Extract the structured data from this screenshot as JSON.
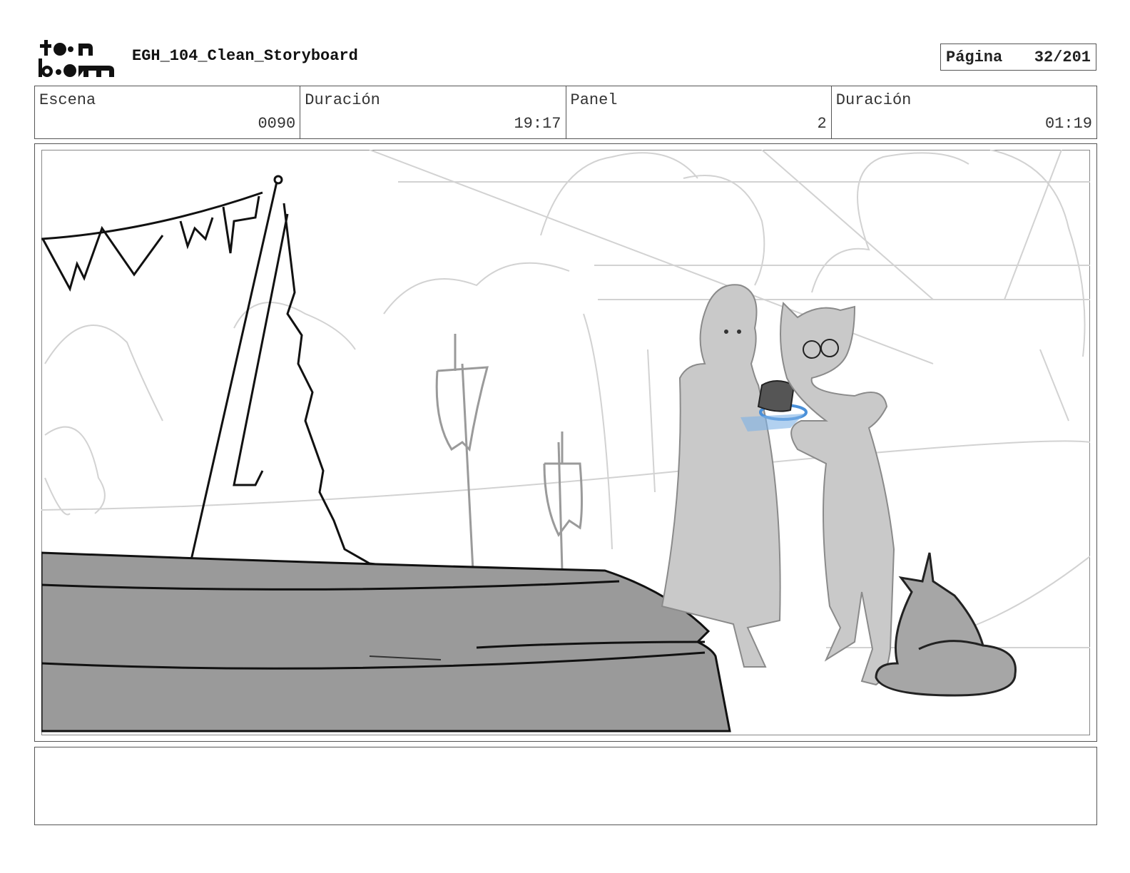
{
  "header": {
    "logo_name": "toonboom-logo",
    "title": "EGH_104_Clean_Storyboard",
    "page_label": "Página",
    "page_value": "32/201"
  },
  "info": {
    "scene_label": "Escena",
    "scene_value": "0090",
    "scene_duration_label": "Duración",
    "scene_duration_value": "19:17",
    "panel_label": "Panel",
    "panel_value": "2",
    "panel_duration_label": "Duración",
    "panel_duration_value": "01:19"
  },
  "notes": {
    "text": ""
  },
  "colors": {
    "border": "#555555",
    "sketch_light": "#c8c8c8",
    "figure_fill": "#c9c9c9",
    "boat_fill": "#9a9a9a",
    "glow_blue": "#4a90d9"
  }
}
